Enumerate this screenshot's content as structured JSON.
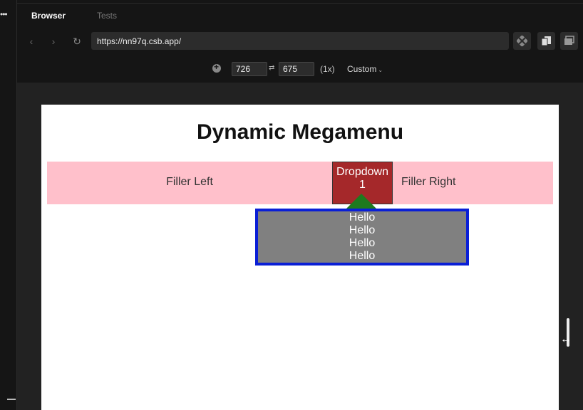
{
  "tabs": {
    "browser": "Browser",
    "tests": "Tests"
  },
  "url": {
    "value": "https://nn97q.csb.app/"
  },
  "responsive": {
    "width": "726",
    "height": "675",
    "scale": "(1x)",
    "preset": "Custom"
  },
  "page": {
    "heading": "Dynamic Megamenu",
    "filler_left": "Filler Left",
    "filler_right": "Filler Right",
    "dropdown_label": "Dropdown 1",
    "megamenu_items": [
      "Hello",
      "Hello",
      "Hello",
      "Hello"
    ]
  },
  "icons": {
    "back": "chevron-left-icon",
    "forward": "chevron-right-icon",
    "reload": "reload-icon",
    "extensions": "extensions-icon",
    "copy": "copy-icon",
    "window": "window-icon",
    "responsive": "responsive-icon",
    "swap": "swap-icon",
    "resize": "resize-horizontal-icon"
  },
  "colors": {
    "menu_bar": "#ffc0cb",
    "dropdown": "#a5282a",
    "caret": "#1e7a1e",
    "megamenu_bg": "#808080",
    "megamenu_border": "#0a1fd6"
  }
}
